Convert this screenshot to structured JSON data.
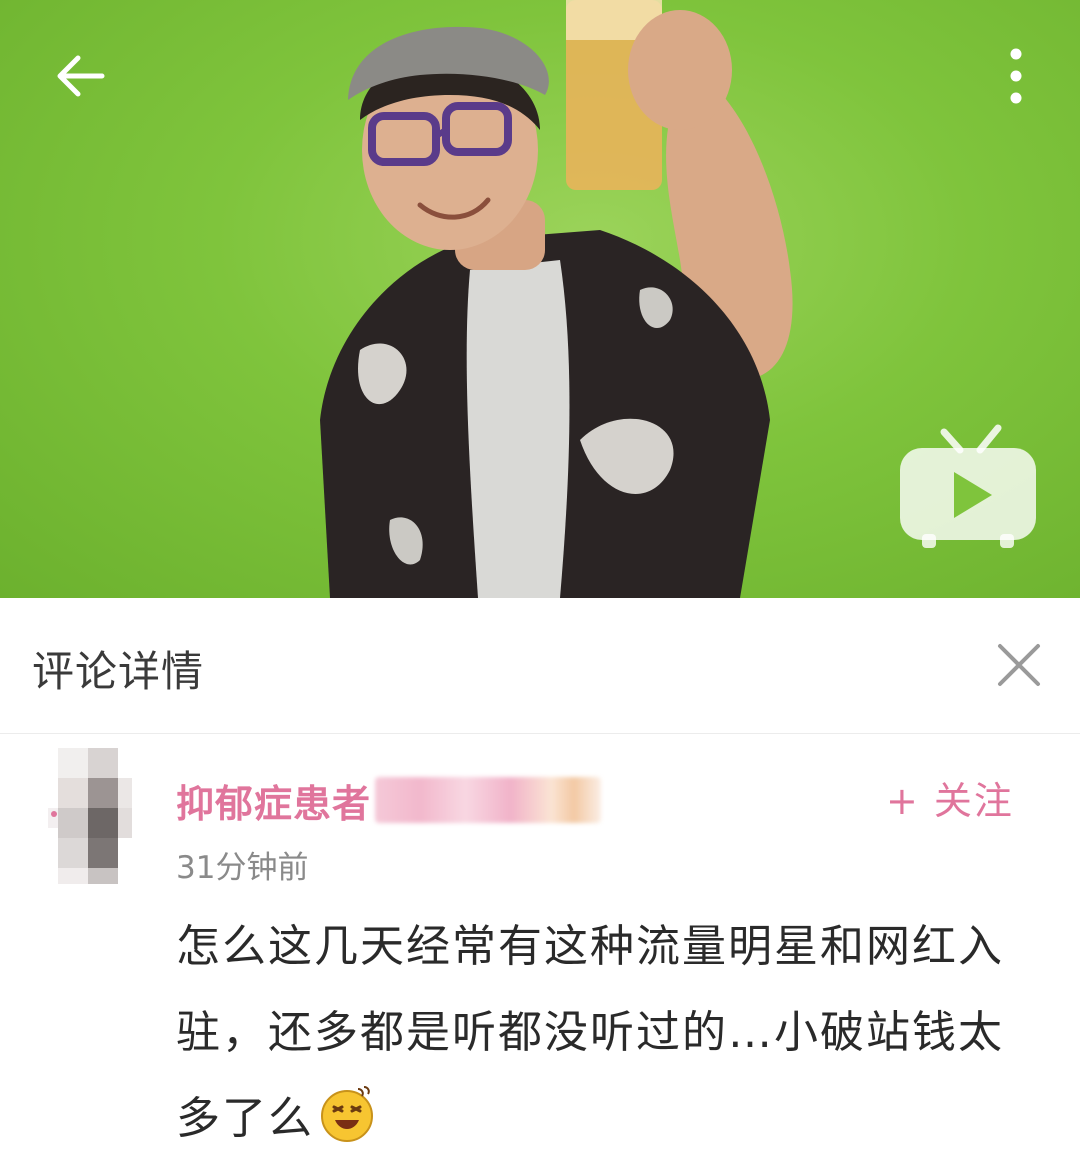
{
  "header": {
    "title": "评论详情"
  },
  "comment": {
    "username": "抑郁症患者",
    "follow_label": "+ 关注",
    "time": "31分钟前",
    "text": "怎么这几天经常有这种流量明星和网红入驻，还多都是听都没听过的…小破站钱太多了么",
    "emoji": "sweat-grin-emoji"
  },
  "icons": {
    "back": "back-arrow-icon",
    "more": "more-vertical-icon",
    "play": "tv-play-icon",
    "close": "close-icon"
  },
  "colors": {
    "accent": "#e0759c",
    "cover_background": "#7fc43c",
    "text_primary": "#2a2a2a",
    "text_secondary": "#8a8a8a"
  }
}
